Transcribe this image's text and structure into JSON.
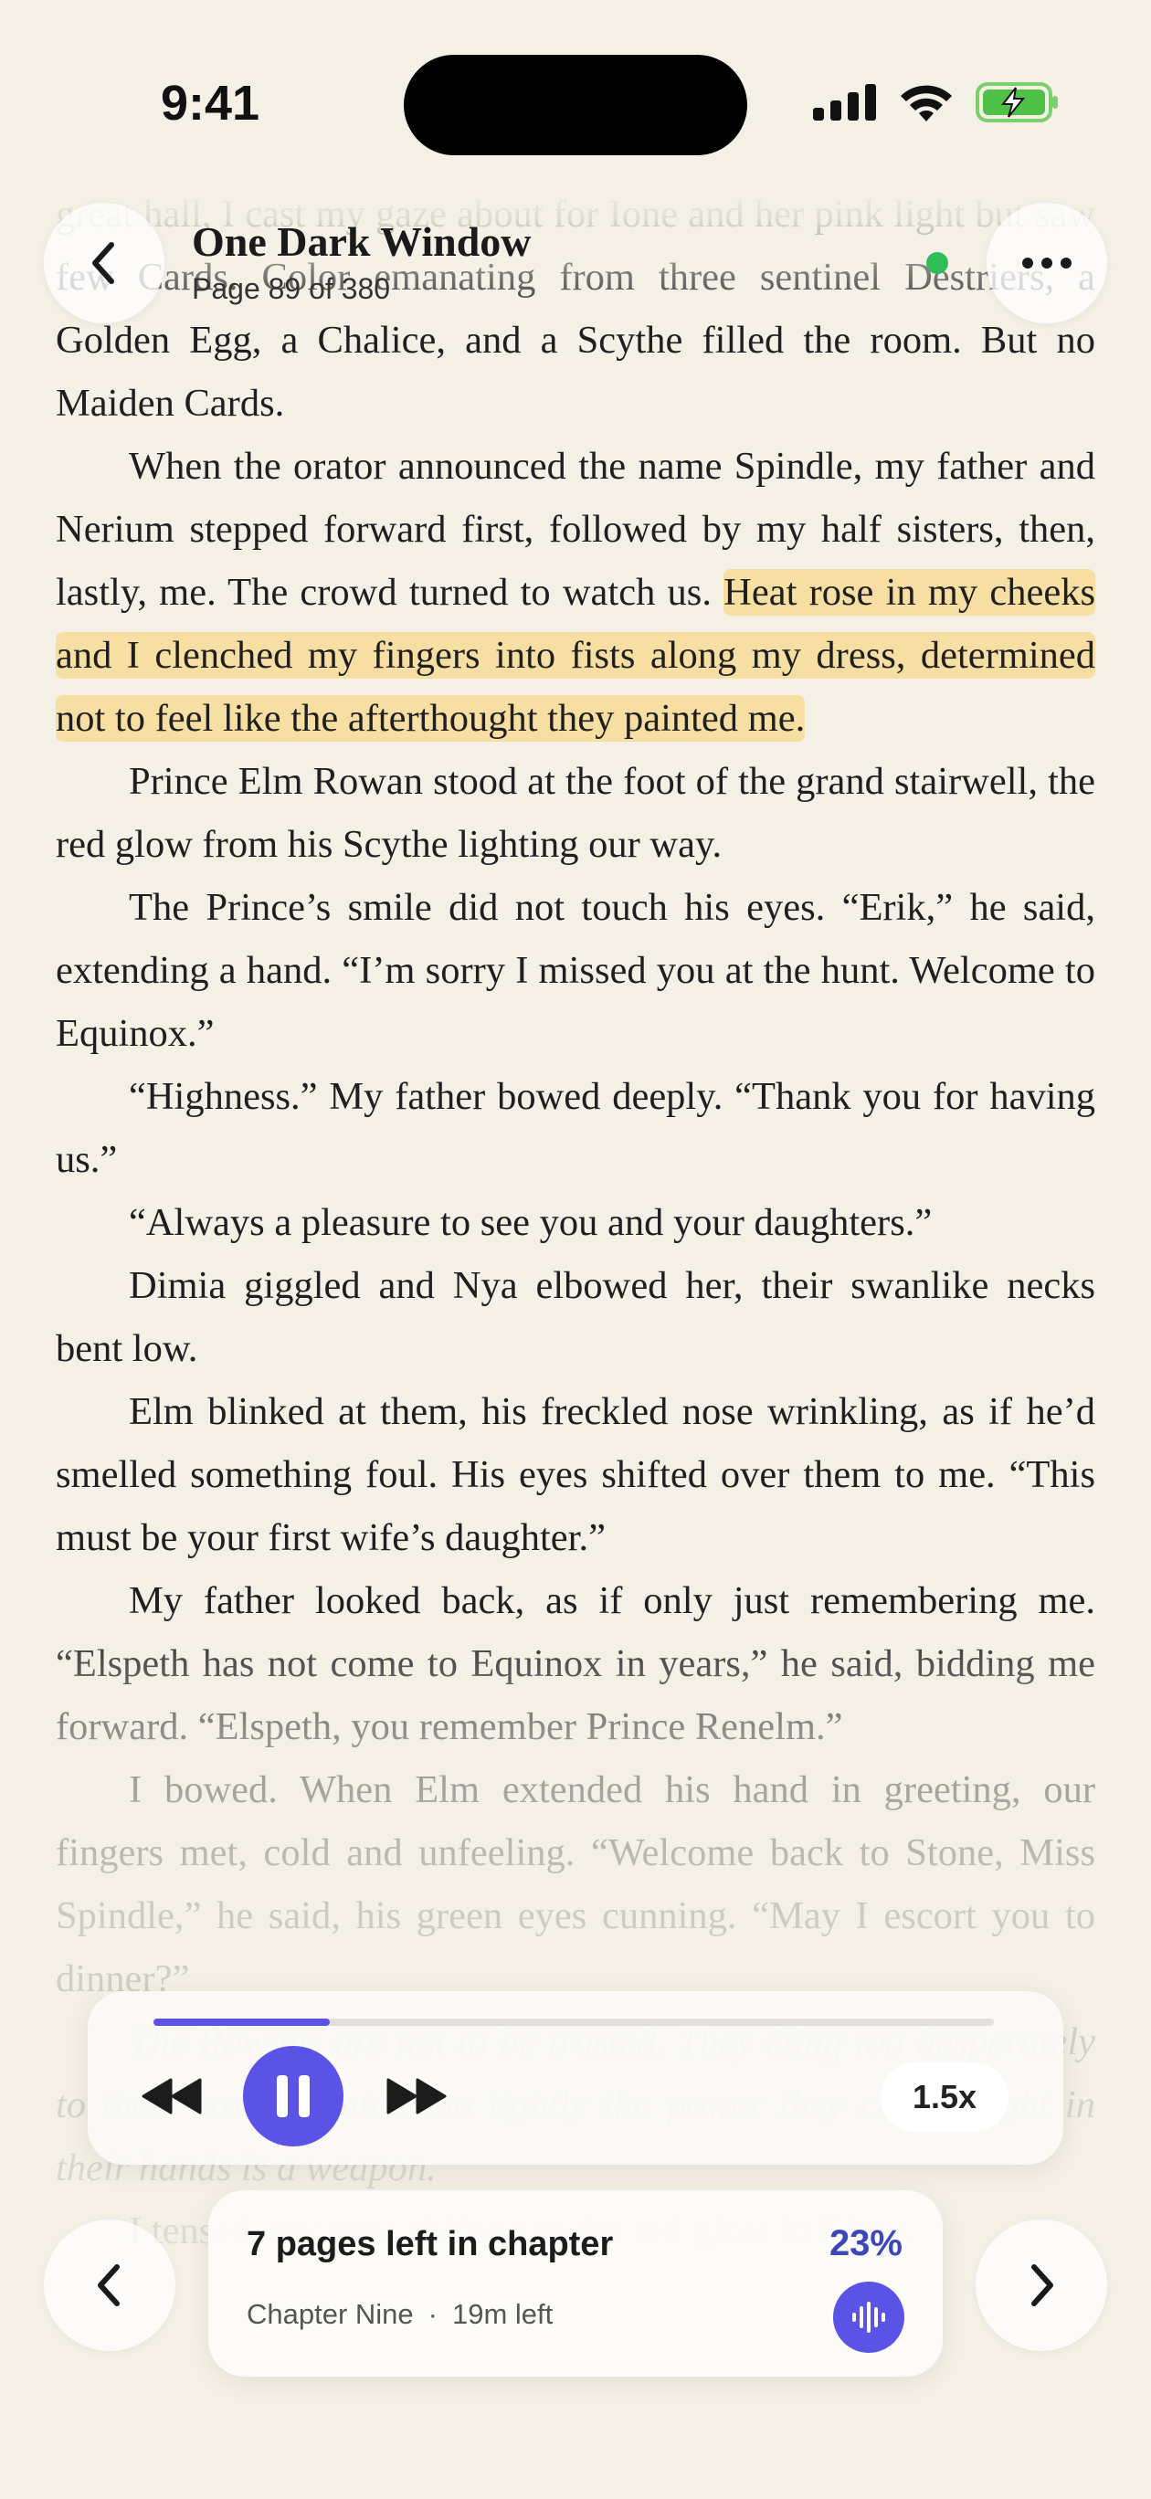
{
  "status_bar": {
    "time": "9:41"
  },
  "header": {
    "title": "One Dark Window",
    "page": "Page 89 of 380",
    "back_icon": "chevron-left-icon",
    "menu_icon": "ellipsis-icon",
    "sync_status_color": "#2fbd57"
  },
  "reader": {
    "p1": "great hall, I cast my gaze about for Ione and her pink light but saw few Cards. Color emanating from three sentinel Destriers, a Golden Egg, a Chalice, and a Scythe filled the room. But no Maiden Cards.",
    "p2_plain": "When the orator announced the name Spindle, my father and Nerium stepped forward first, followed by my half sisters, then, lastly, me. The crowd turned to watch us. ",
    "p2_highlight": "Heat rose in my cheeks and I clenched my fingers into fists along my dress, determined not to feel like the afterthought they painted me.",
    "p3": "Prince Elm Rowan stood at the foot of the grand stairwell, the red glow from his Scythe lighting our way.",
    "p4": "The Prince’s smile did not touch his eyes. “Erik,” he said, extending a hand. “I’m sorry I missed you at the hunt. Welcome to Equinox.”",
    "p5": "“Highness.” My father bowed deeply. “Thank you for having us.”",
    "p6": "“Always a pleasure to see you and your daughters.”",
    "p7": "Dimia giggled and Nya elbowed her, their swanlike necks bent low.",
    "p8": "Elm blinked at them, his freckled nose wrinkling, as if he’d smelled something foul. His eyes shifted over them to me. “This must be your first wife’s daughter.”",
    "p9": "My father looked back, as if only just remembering me. “Elspeth has not come to Equinox in years,” he said, bidding me forward. “Elspeth, you remember Prince Renelm.”",
    "p10": "I bowed. When Elm extended his hand in greeting, our fingers met, cold and unfeeling. “Welcome back to Stone, Miss Spindle,” he said, his green eyes cunning. “May I escort you to dinner?”",
    "p11": "The Rowans are not to be trusted. They cling too desperately to their crown, clutch too tightly the power they covet. Light in their hands is a weapon.",
    "p12": "I tensed, my eyes shifting to the red glow in Elm’s"
  },
  "player": {
    "progress": 0.21,
    "rewind_icon": "rewind-icon",
    "pause_icon": "pause-icon",
    "forward_icon": "fast-forward-icon",
    "speed": "1.5x",
    "accent": "#5b52e6"
  },
  "chapter": {
    "pages_left": "7 pages left in chapter",
    "percent": "23%",
    "name": "Chapter Nine",
    "separator": "·",
    "time_left": "19m left",
    "audio_icon": "waveform-icon"
  },
  "nav": {
    "prev_icon": "chevron-left-icon",
    "next_icon": "chevron-right-icon"
  }
}
